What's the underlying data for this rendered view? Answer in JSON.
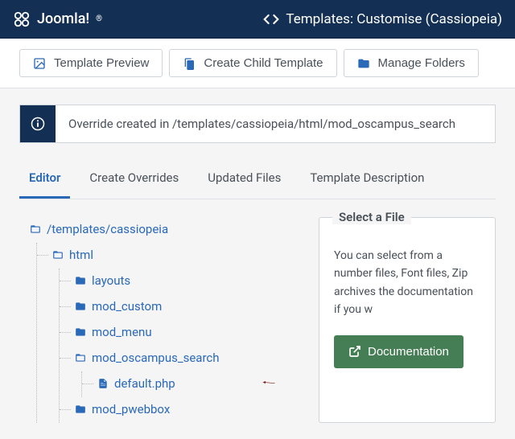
{
  "header": {
    "brand": "Joomla!",
    "page_title": "Templates: Customise (Cassiopeia)"
  },
  "toolbar": {
    "preview": "Template Preview",
    "child": "Create Child Template",
    "folders": "Manage Folders"
  },
  "alert": {
    "message": "Override created in /templates/cassiopeia/html/mod_oscampus_search"
  },
  "tabs": {
    "editor": "Editor",
    "overrides": "Create Overrides",
    "updated": "Updated Files",
    "description": "Template Description"
  },
  "tree": {
    "root": "/templates/cassiopeia",
    "html": "html",
    "layouts": "layouts",
    "mod_custom": "mod_custom",
    "mod_menu": "mod_menu",
    "mod_oscampus_search": "mod_oscampus_search",
    "default_php": "default.php",
    "mod_pwebbox": "mod_pwebbox"
  },
  "right": {
    "legend": "Select a File",
    "text": "You can select from a number files, Font files, Zip archives the documentation if you w",
    "doc_btn": "Documentation"
  },
  "colors": {
    "primary": "#2a69b8",
    "headerbg": "#132f53",
    "docbtn": "#457d54"
  }
}
